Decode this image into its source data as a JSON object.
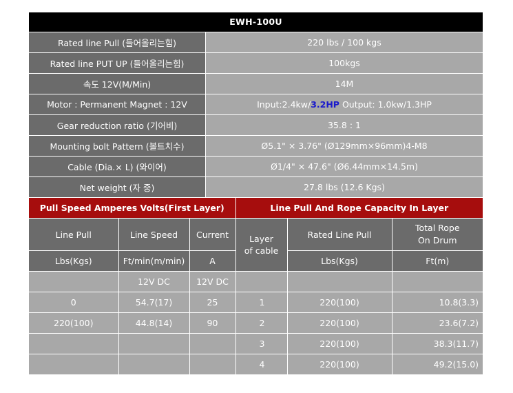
{
  "title": "EWH-100U",
  "specs": [
    {
      "label": "Rated line Pull (들어올리는힘)",
      "value": "220 lbs / 100 kgs"
    },
    {
      "label": "Rated line PUT UP (들어올리는힘)",
      "value": "100kgs"
    },
    {
      "label": "속도 12V(M/Min)",
      "value": "14M"
    },
    {
      "label": "Motor : Permanent Magnet : 12V",
      "value_pre": "Input:2.4kw/",
      "value_hp": "3.2HP",
      "value_post": " Output: 1.0kw/1.3HP"
    },
    {
      "label": "Gear reduction ratio (기어비)",
      "value": "35.8 : 1"
    },
    {
      "label": "Mounting bolt Pattern (볼트치수)",
      "value": "Ø5.1\" × 3.76\" (Ø129mm×96mm)4-M8"
    },
    {
      "label": "Cable (Dia.× L) (와이어)",
      "value": "Ø1/4\" × 47.6\" (Ø6.44mm×14.5m)"
    },
    {
      "label": "Net weight (자 중)",
      "value": "27.8 lbs (12.6 Kgs)"
    }
  ],
  "left_section": {
    "title": "Pull Speed Amperes Volts(First Layer)",
    "headers": [
      "Line Pull",
      "Line Speed",
      "Current"
    ],
    "units": [
      "Lbs(Kgs)",
      "Ft/min(m/min)",
      "A"
    ],
    "voltage_row": [
      "",
      "12V DC",
      "12V DC"
    ],
    "rows": [
      [
        "0",
        "54.7(17)",
        "25"
      ],
      [
        "220(100)",
        "44.8(14)",
        "90"
      ],
      [
        "",
        "",
        ""
      ],
      [
        "",
        "",
        ""
      ]
    ]
  },
  "right_section": {
    "title": "Line Pull And Rope Capacity In Layer",
    "headers": [
      "Layer\nof cable",
      "Rated Line Pull",
      "Total Rope\nOn Drum"
    ],
    "units": [
      "Lbs(Kgs)",
      "Ft(m)"
    ],
    "rows": [
      [
        "1",
        "220(100)",
        "10.8(3.3)"
      ],
      [
        "2",
        "220(100)",
        "23.6(7.2)"
      ],
      [
        "3",
        "220(100)",
        "38.3(11.7)"
      ],
      [
        "4",
        "220(100)",
        "49.2(15.0)"
      ]
    ]
  },
  "colors": {
    "header_black": "#000000",
    "label_gray": "#6b6b6b",
    "value_gray": "#a8a8a8",
    "section_red": "#a60d0d",
    "hp_blue": "#1a1acc"
  }
}
